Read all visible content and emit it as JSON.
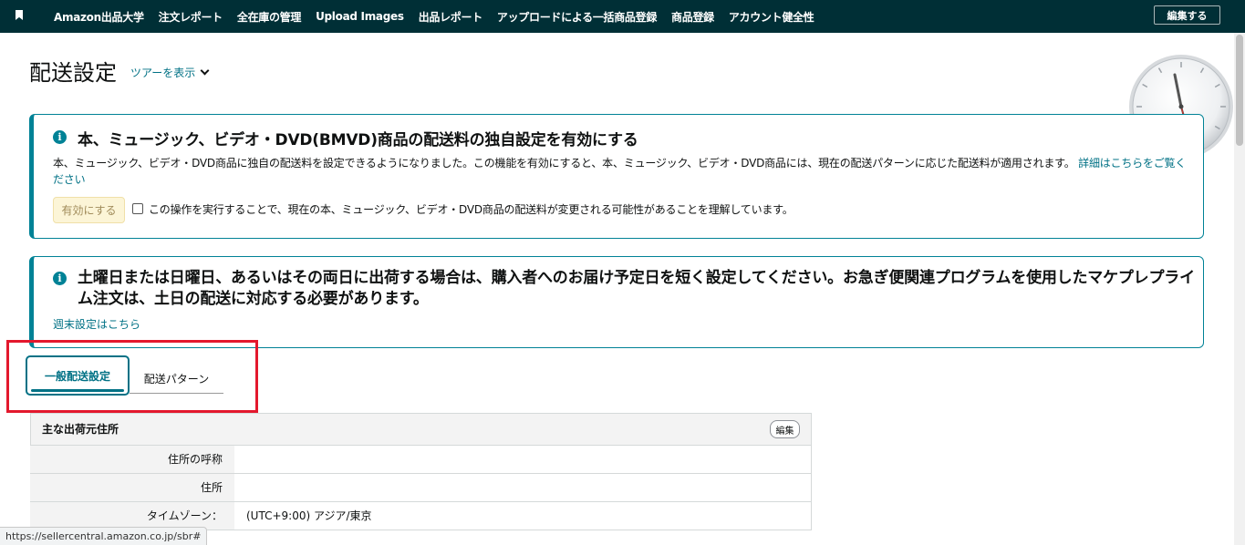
{
  "nav": {
    "items": [
      "Amazon出品大学",
      "注文レポート",
      "全在庫の管理",
      "Upload Images",
      "出品レポート",
      "アップロードによる一括商品登録",
      "商品登録",
      "アカウント健全性"
    ],
    "edit_label": "編集する"
  },
  "header": {
    "title": "配送設定",
    "tour_label": "ツアーを表示"
  },
  "alert_bmvd": {
    "title": "本、ミュージック、ビデオ・DVD(BMVD)商品の配送料の独自設定を有効にする",
    "body": "本、ミュージック、ビデオ・DVD商品に独自の配送料を設定できるようになりました。この機能を有効にすると、本、ミュージック、ビデオ・DVD商品には、現在の配送パターンに応じた配送料が適用されます。",
    "link": "詳細はこちらをご覧ください",
    "enable_label": "有効にする",
    "checkbox_label": "この操作を実行することで、現在の本、ミュージック、ビデオ・DVD商品の配送料が変更される可能性があることを理解しています。"
  },
  "alert_weekend": {
    "title": "土曜日または日曜日、あるいはその両日に出荷する場合は、購入者へのお届け予定日を短く設定してください。お急ぎ便関連プログラムを使用したマケプレプライム注文は、土日の配送に対応する必要があります。",
    "link": "週末設定はこちら"
  },
  "tabs": [
    {
      "label": "一般配送設定",
      "active": true
    },
    {
      "label": "配送パターン",
      "active": false
    }
  ],
  "address": {
    "title": "主な出荷元住所",
    "edit_label": "編集",
    "rows": [
      {
        "label": "住所の呼称",
        "value": ""
      },
      {
        "label": "住所",
        "value": ""
      },
      {
        "label": "タイムゾーン：",
        "value": "(UTC+9:00) アジア/東京"
      }
    ]
  },
  "status_url": "https://sellercentral.amazon.co.jp/sbr#",
  "colors": {
    "nav_bg": "#002f36",
    "accent": "#007185",
    "alert_border": "#008296",
    "highlight": "#e3182d"
  }
}
